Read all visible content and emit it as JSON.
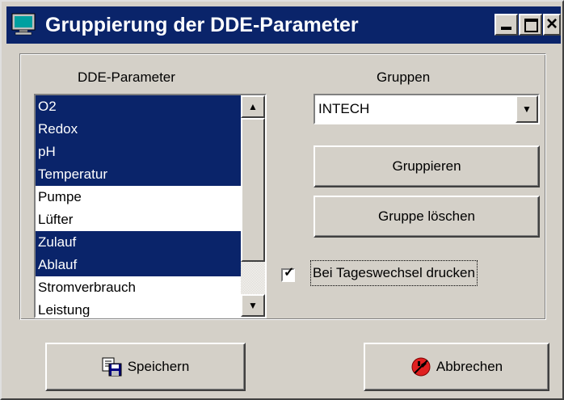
{
  "window": {
    "title": "Gruppierung der DDE-Parameter",
    "icon": "monitor-icon",
    "controls": {
      "minimize": "minimize-icon",
      "maximize": "maximize-icon",
      "close": "×"
    }
  },
  "dde_parameter": {
    "heading": "DDE-Parameter",
    "items": [
      {
        "label": "O2",
        "selected": true
      },
      {
        "label": "Redox",
        "selected": true
      },
      {
        "label": "pH",
        "selected": true
      },
      {
        "label": "Temperatur",
        "selected": true
      },
      {
        "label": "Pumpe",
        "selected": false
      },
      {
        "label": "Lüfter",
        "selected": false
      },
      {
        "label": "Zulauf",
        "selected": true
      },
      {
        "label": "Ablauf",
        "selected": true
      },
      {
        "label": "Stromverbrauch",
        "selected": false
      },
      {
        "label": "Leistung",
        "selected": false
      }
    ]
  },
  "gruppen": {
    "heading": "Gruppen",
    "selected_value": "INTECH",
    "group_button_label": "Gruppieren",
    "delete_button_label": "Gruppe löschen"
  },
  "print_option": {
    "label": "Bei Tageswechsel drucken",
    "checked": true
  },
  "footer": {
    "save_label": "Speichern",
    "cancel_label": "Abbrechen",
    "save_icon": "floppy-save-icon",
    "cancel_icon": "stop-cancel-icon"
  },
  "colors": {
    "face": "#d4d0c8",
    "titlebar": "#0a246a",
    "selection": "#0a246a"
  }
}
